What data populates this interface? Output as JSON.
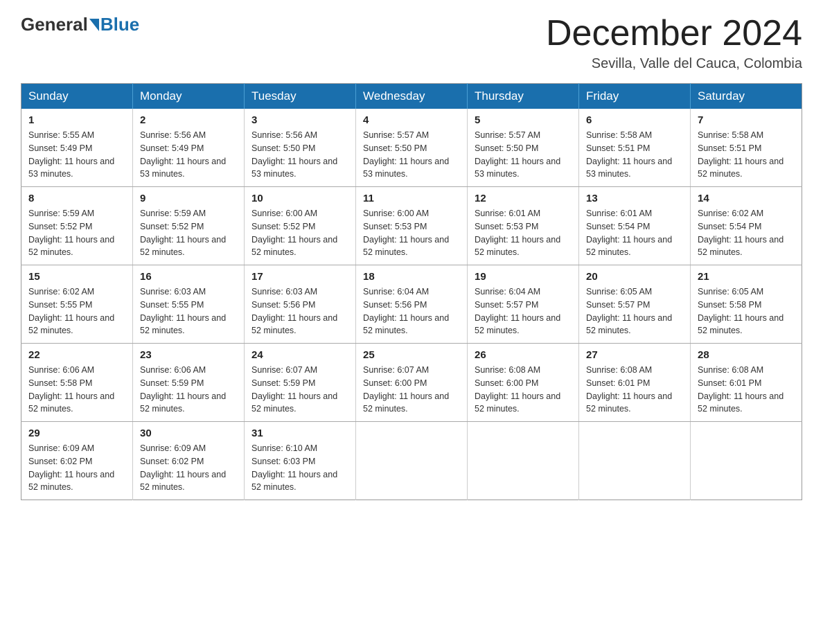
{
  "header": {
    "logo_general": "General",
    "logo_blue": "Blue",
    "title": "December 2024",
    "subtitle": "Sevilla, Valle del Cauca, Colombia"
  },
  "weekdays": [
    "Sunday",
    "Monday",
    "Tuesday",
    "Wednesday",
    "Thursday",
    "Friday",
    "Saturday"
  ],
  "weeks": [
    [
      {
        "day": "1",
        "sunrise": "5:55 AM",
        "sunset": "5:49 PM",
        "daylight": "11 hours and 53 minutes."
      },
      {
        "day": "2",
        "sunrise": "5:56 AM",
        "sunset": "5:49 PM",
        "daylight": "11 hours and 53 minutes."
      },
      {
        "day": "3",
        "sunrise": "5:56 AM",
        "sunset": "5:50 PM",
        "daylight": "11 hours and 53 minutes."
      },
      {
        "day": "4",
        "sunrise": "5:57 AM",
        "sunset": "5:50 PM",
        "daylight": "11 hours and 53 minutes."
      },
      {
        "day": "5",
        "sunrise": "5:57 AM",
        "sunset": "5:50 PM",
        "daylight": "11 hours and 53 minutes."
      },
      {
        "day": "6",
        "sunrise": "5:58 AM",
        "sunset": "5:51 PM",
        "daylight": "11 hours and 53 minutes."
      },
      {
        "day": "7",
        "sunrise": "5:58 AM",
        "sunset": "5:51 PM",
        "daylight": "11 hours and 52 minutes."
      }
    ],
    [
      {
        "day": "8",
        "sunrise": "5:59 AM",
        "sunset": "5:52 PM",
        "daylight": "11 hours and 52 minutes."
      },
      {
        "day": "9",
        "sunrise": "5:59 AM",
        "sunset": "5:52 PM",
        "daylight": "11 hours and 52 minutes."
      },
      {
        "day": "10",
        "sunrise": "6:00 AM",
        "sunset": "5:52 PM",
        "daylight": "11 hours and 52 minutes."
      },
      {
        "day": "11",
        "sunrise": "6:00 AM",
        "sunset": "5:53 PM",
        "daylight": "11 hours and 52 minutes."
      },
      {
        "day": "12",
        "sunrise": "6:01 AM",
        "sunset": "5:53 PM",
        "daylight": "11 hours and 52 minutes."
      },
      {
        "day": "13",
        "sunrise": "6:01 AM",
        "sunset": "5:54 PM",
        "daylight": "11 hours and 52 minutes."
      },
      {
        "day": "14",
        "sunrise": "6:02 AM",
        "sunset": "5:54 PM",
        "daylight": "11 hours and 52 minutes."
      }
    ],
    [
      {
        "day": "15",
        "sunrise": "6:02 AM",
        "sunset": "5:55 PM",
        "daylight": "11 hours and 52 minutes."
      },
      {
        "day": "16",
        "sunrise": "6:03 AM",
        "sunset": "5:55 PM",
        "daylight": "11 hours and 52 minutes."
      },
      {
        "day": "17",
        "sunrise": "6:03 AM",
        "sunset": "5:56 PM",
        "daylight": "11 hours and 52 minutes."
      },
      {
        "day": "18",
        "sunrise": "6:04 AM",
        "sunset": "5:56 PM",
        "daylight": "11 hours and 52 minutes."
      },
      {
        "day": "19",
        "sunrise": "6:04 AM",
        "sunset": "5:57 PM",
        "daylight": "11 hours and 52 minutes."
      },
      {
        "day": "20",
        "sunrise": "6:05 AM",
        "sunset": "5:57 PM",
        "daylight": "11 hours and 52 minutes."
      },
      {
        "day": "21",
        "sunrise": "6:05 AM",
        "sunset": "5:58 PM",
        "daylight": "11 hours and 52 minutes."
      }
    ],
    [
      {
        "day": "22",
        "sunrise": "6:06 AM",
        "sunset": "5:58 PM",
        "daylight": "11 hours and 52 minutes."
      },
      {
        "day": "23",
        "sunrise": "6:06 AM",
        "sunset": "5:59 PM",
        "daylight": "11 hours and 52 minutes."
      },
      {
        "day": "24",
        "sunrise": "6:07 AM",
        "sunset": "5:59 PM",
        "daylight": "11 hours and 52 minutes."
      },
      {
        "day": "25",
        "sunrise": "6:07 AM",
        "sunset": "6:00 PM",
        "daylight": "11 hours and 52 minutes."
      },
      {
        "day": "26",
        "sunrise": "6:08 AM",
        "sunset": "6:00 PM",
        "daylight": "11 hours and 52 minutes."
      },
      {
        "day": "27",
        "sunrise": "6:08 AM",
        "sunset": "6:01 PM",
        "daylight": "11 hours and 52 minutes."
      },
      {
        "day": "28",
        "sunrise": "6:08 AM",
        "sunset": "6:01 PM",
        "daylight": "11 hours and 52 minutes."
      }
    ],
    [
      {
        "day": "29",
        "sunrise": "6:09 AM",
        "sunset": "6:02 PM",
        "daylight": "11 hours and 52 minutes."
      },
      {
        "day": "30",
        "sunrise": "6:09 AM",
        "sunset": "6:02 PM",
        "daylight": "11 hours and 52 minutes."
      },
      {
        "day": "31",
        "sunrise": "6:10 AM",
        "sunset": "6:03 PM",
        "daylight": "11 hours and 52 minutes."
      },
      null,
      null,
      null,
      null
    ]
  ],
  "labels": {
    "sunrise": "Sunrise:",
    "sunset": "Sunset:",
    "daylight": "Daylight:"
  }
}
